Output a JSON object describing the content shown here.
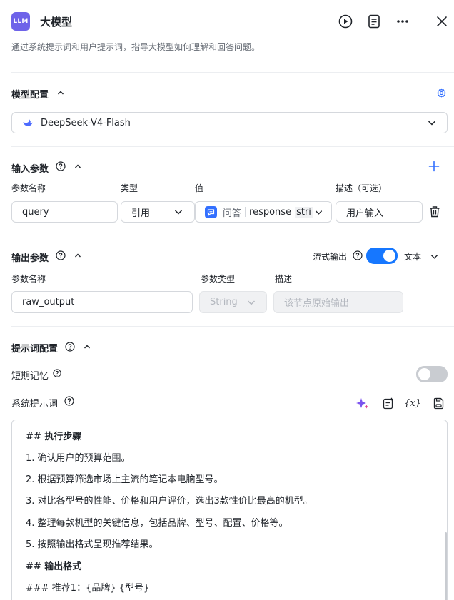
{
  "header": {
    "badge": "LLM",
    "title": "大模型",
    "description": "通过系统提示词和用户提示词，指导大模型如何理解和回答问题。"
  },
  "model_config": {
    "title": "模型配置",
    "model_name": "DeepSeek-V4-Flash"
  },
  "input_params": {
    "title": "输入参数",
    "col_name": "参数名称",
    "col_type": "类型",
    "col_value": "值",
    "col_desc": "描述（可选）",
    "row": {
      "name": "query",
      "type": "引用",
      "value_source": "问答",
      "value_field": "response",
      "value_type": "stri",
      "desc": "用户输入"
    }
  },
  "output_params": {
    "title": "输出参数",
    "stream_label": "流式输出",
    "stream_on": true,
    "format": "文本",
    "col_name": "参数名称",
    "col_type": "参数类型",
    "col_desc": "描述",
    "row": {
      "name": "raw_output",
      "type": "String",
      "desc_placeholder": "该节点原始输出"
    }
  },
  "prompt_config": {
    "title": "提示词配置",
    "short_memory_label": "短期记忆",
    "short_memory_on": false,
    "system_prompt_label": "系统提示词",
    "variable_btn": "{x}",
    "editor_lines": [
      "## 执行步骤",
      "1. 确认用户的预算范围。",
      "2. 根据预算筛选市场上主流的笔记本电脑型号。",
      "3. 对比各型号的性能、价格和用户评价，选出3款性价比最高的机型。",
      "4. 整理每款机型的关键信息，包括品牌、型号、配置、价格等。",
      "5. 按照输出格式呈现推荐结果。",
      "## 输出格式",
      " ### 推荐1：{品牌} {型号}"
    ]
  },
  "colors": {
    "accent": "#3370ff",
    "badge": "#6e63e9",
    "toggle_on": "#1677ff",
    "toggle_off": "#c9ccd1"
  }
}
